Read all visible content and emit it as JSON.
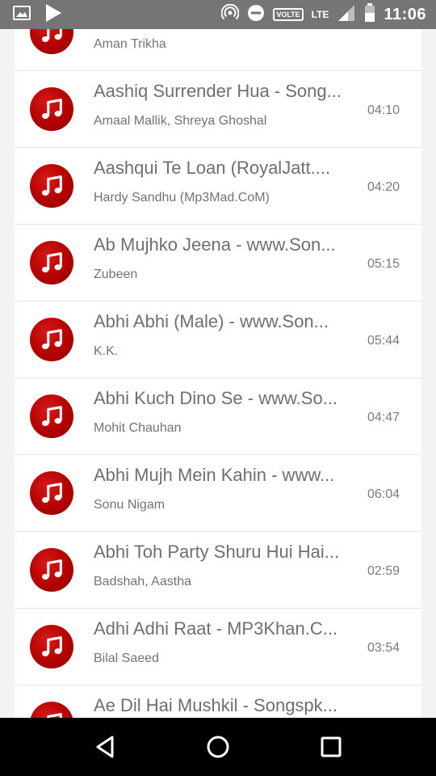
{
  "status_bar": {
    "time": "11:06",
    "volte_label": "VOLTE",
    "lte_label": "LTE",
    "icons": [
      "image-icon",
      "play-store-icon",
      "hotspot-icon",
      "dnd-icon",
      "signal-icon",
      "battery-icon"
    ]
  },
  "songs": [
    {
      "title": "",
      "artist": "Aman Trikha",
      "duration": ""
    },
    {
      "title": "Aashiq Surrender Hua - Song...",
      "artist": "Amaal Mallik, Shreya Ghoshal",
      "duration": "04:10"
    },
    {
      "title": "Aashqui Te Loan (RoyalJatt....",
      "artist": "Hardy Sandhu (Mp3Mad.CoM)",
      "duration": "04:20"
    },
    {
      "title": "Ab Mujhko Jeena - www.Son...",
      "artist": "Zubeen",
      "duration": "05:15"
    },
    {
      "title": "Abhi Abhi (Male) - www.Son...",
      "artist": "K.K.",
      "duration": "05:44"
    },
    {
      "title": "Abhi Kuch Dino Se - www.So...",
      "artist": "Mohit Chauhan",
      "duration": "04:47"
    },
    {
      "title": "Abhi Mujh Mein Kahin - www...",
      "artist": "Sonu Nigam",
      "duration": "06:04"
    },
    {
      "title": "Abhi Toh Party Shuru Hui Hai...",
      "artist": "Badshah, Aastha",
      "duration": "02:59"
    },
    {
      "title": "Adhi Adhi Raat - MP3Khan.C...",
      "artist": "Bilal Saeed",
      "duration": "03:54"
    },
    {
      "title": "Ae Dil Hai Mushkil - Songspk...",
      "artist": "",
      "duration": ""
    }
  ],
  "nav_bar": {
    "icons": [
      "back-icon",
      "home-icon",
      "recents-icon"
    ]
  },
  "colors": {
    "accent_red": "#b30000",
    "status_bar_bg": "#757575",
    "nav_bar_bg": "#000000"
  }
}
